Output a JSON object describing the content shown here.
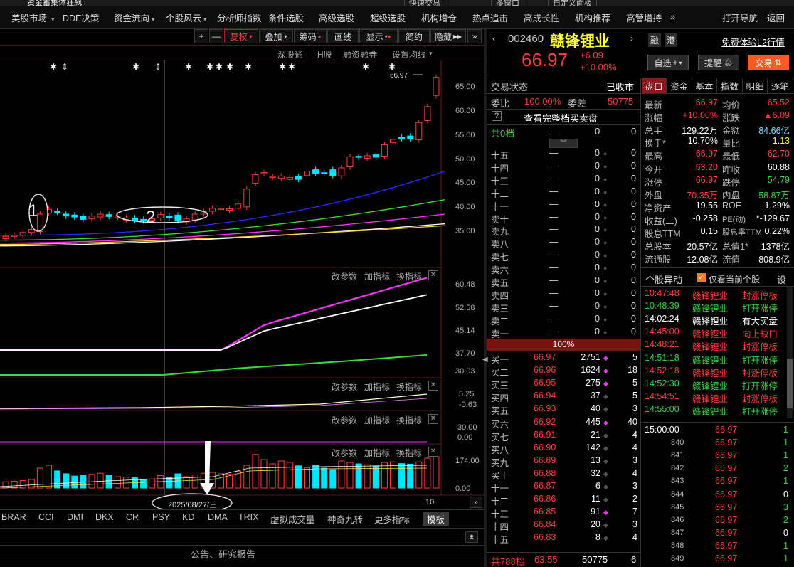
{
  "window": {
    "title": "资金蓄集体狂飙!",
    "top_buttons": [
      "快速交易",
      "多窗口",
      "自定义面板"
    ]
  },
  "menu": [
    "美股市场",
    "DDE决策",
    "资金流向",
    "个股风云",
    "分析师指数",
    "条件选股",
    "高级选股",
    "超级选股",
    "机构增仓",
    "热点追击",
    "高成长性",
    "机构推荐",
    "高管增持",
    "»"
  ],
  "menu_right": {
    "nav": "打开导航",
    "back": "返回"
  },
  "chart_toolbar": {
    "plus": "+",
    "minus": "—",
    "fuquan": "复权",
    "overlay": "叠加",
    "chouma": "筹码",
    "draw": "画线",
    "display": "显示",
    "simple": "简约",
    "hide": "隐藏"
  },
  "chart_links": [
    "深股通",
    "H股",
    "融资融券",
    "设置均线"
  ],
  "stock": {
    "code": "002460",
    "name": "赣锋锂业",
    "price": "66.97",
    "change": "+6.09",
    "change_pct": "+10.00%",
    "badge1": "融",
    "badge2": "港",
    "l2": "免费体验L2行情",
    "btn_zixuan": "自选",
    "btn_tixing": "提醒",
    "btn_jiaoyi": "交易"
  },
  "price_marker": "66.97",
  "annotations": {
    "circle1": "1",
    "circle2": "2",
    "date": "2025/08/27/三"
  },
  "y_axis_main": [
    "65.00",
    "60.00",
    "55.00",
    "50.00",
    "45.00",
    "40.00",
    "35.00"
  ],
  "y_axis_ind1": [
    "60.48",
    "52.58",
    "45.14",
    "37.70",
    "30.03"
  ],
  "y_axis_ind2": [
    "5.25",
    "-0.63"
  ],
  "y_axis_ind3": [
    "30.00",
    "0.00"
  ],
  "y_axis_vol": [
    "174.00",
    "0.00"
  ],
  "panel_links": [
    "改参数",
    "加指标",
    "换指标"
  ],
  "bottom_tabs": [
    "BRAR",
    "CCI",
    "DMI",
    "DKX",
    "CR",
    "PSY",
    "KD",
    "DMA",
    "TRIX",
    "虚拟成交量",
    "神奇九转",
    "更多指标",
    "模板"
  ],
  "page_num": "10",
  "footer": "公告、研究报告",
  "trade_status": {
    "label": "交易状态",
    "value": "已收市",
    "weibi_label": "委比",
    "weibi": "100.00%",
    "weicha_label": "委差",
    "weicha": "50775",
    "full_book": "查看完整档买卖盘",
    "total0": "共0档",
    "dash": "—",
    "zero": "0"
  },
  "sell_levels": [
    "十五",
    "十四",
    "十三",
    "十二",
    "十一",
    "卖十",
    "卖九",
    "卖八",
    "卖七",
    "卖六",
    "卖五",
    "卖四",
    "卖三",
    "卖二",
    "卖一"
  ],
  "ratio_bar": "100%",
  "buy_levels": [
    [
      "买一",
      "66.97",
      "2751",
      "5"
    ],
    [
      "买二",
      "66.96",
      "1624",
      "18"
    ],
    [
      "买三",
      "66.95",
      "275",
      "5"
    ],
    [
      "买四",
      "66.94",
      "37",
      "5"
    ],
    [
      "买五",
      "66.93",
      "40",
      "3"
    ],
    [
      "买六",
      "66.92",
      "445",
      "40"
    ],
    [
      "买七",
      "66.91",
      "21",
      "4"
    ],
    [
      "买八",
      "66.90",
      "142",
      "4"
    ],
    [
      "买九",
      "66.89",
      "13",
      "3"
    ],
    [
      "买十",
      "66.88",
      "32",
      "4"
    ],
    [
      "十一",
      "66.87",
      "6",
      "3"
    ],
    [
      "十二",
      "66.86",
      "11",
      "2"
    ],
    [
      "十三",
      "66.85",
      "91",
      "7"
    ],
    [
      "十四",
      "66.84",
      "20",
      "3"
    ],
    [
      "十五",
      "66.83",
      "8",
      "4"
    ]
  ],
  "book_total": {
    "label": "共788档",
    "price": "63.55",
    "vol": "50775",
    "cnt": "6"
  },
  "tabs": [
    "盘口",
    "资金",
    "基本",
    "指数",
    "明细",
    "逐笔"
  ],
  "stats": [
    [
      "最新",
      "66.97",
      "均价",
      "65.52"
    ],
    [
      "涨幅",
      "+10.00%",
      "涨跌",
      "▲6.09"
    ],
    [
      "总手",
      "129.22万",
      "金额",
      "84.66亿"
    ],
    [
      "换手*",
      "10.70%",
      "量比",
      "1.13"
    ],
    [
      "最高",
      "66.97",
      "最低",
      "62.70"
    ],
    [
      "今开",
      "63.20",
      "昨收",
      "60.88"
    ],
    [
      "涨停",
      "66.97",
      "跌停",
      "54.79"
    ],
    [
      "外盘",
      "70.35万",
      "内盘",
      "58.87万"
    ],
    [
      "净资产",
      "19.55",
      "ROE",
      "-1.29%"
    ],
    [
      "收益(二)",
      "-0.258",
      "PE(动)",
      "*-129.67"
    ],
    [
      "股息TTM",
      "0.15",
      "股息率TTM",
      "0.22%"
    ],
    [
      "总股本",
      "20.57亿",
      "总值1*",
      "1378亿"
    ],
    [
      "流通股",
      "12.08亿",
      "流值",
      "808.9亿"
    ]
  ],
  "anomaly": {
    "title": "个股异动",
    "only_current": "仅看当前个股",
    "settings": "设"
  },
  "anomaly_rows": [
    [
      "10:47:48",
      "赣锋锂业",
      "封涨停板",
      "red"
    ],
    [
      "10:48:39",
      "赣锋锂业",
      "打开涨停",
      "green"
    ],
    [
      "14:02:24",
      "赣锋锂业",
      "有大买盘",
      "white"
    ],
    [
      "14:45:00",
      "赣锋锂业",
      "向上缺口",
      "red"
    ],
    [
      "14:48:21",
      "赣锋锂业",
      "封涨停板",
      "red"
    ],
    [
      "14:51:18",
      "赣锋锂业",
      "打开涨停",
      "green"
    ],
    [
      "14:52:18",
      "赣锋锂业",
      "封涨停板",
      "red"
    ],
    [
      "14:52:30",
      "赣锋锂业",
      "打开涨停",
      "green"
    ],
    [
      "14:54:51",
      "赣锋锂业",
      "封涨停板",
      "red"
    ],
    [
      "14:55:00",
      "赣锋锂业",
      "打开涨停",
      "green"
    ]
  ],
  "ticks": [
    [
      "15:00:00",
      "66.97",
      "1"
    ],
    [
      "840",
      "66.97",
      "1"
    ],
    [
      "841",
      "66.97",
      "1"
    ],
    [
      "842",
      "66.97",
      "2"
    ],
    [
      "843",
      "66.97",
      "1"
    ],
    [
      "844",
      "66.97",
      "0"
    ],
    [
      "845",
      "66.97",
      "3"
    ],
    [
      "846",
      "66.97",
      "2"
    ],
    [
      "847",
      "66.97",
      "0"
    ],
    [
      "848",
      "66.97",
      "1"
    ],
    [
      "849",
      "66.97",
      "1"
    ]
  ],
  "chart_data": {
    "type": "candlestick",
    "candles": [
      [
        33.5,
        34.0
      ],
      [
        34.0,
        34.2
      ],
      [
        34.2,
        34.8
      ],
      [
        34.8,
        35.4
      ],
      [
        35.0,
        38.6
      ],
      [
        38.8,
        39.6
      ],
      [
        39.2,
        39.0
      ],
      [
        38.6,
        38.2
      ],
      [
        38.4,
        38.0
      ],
      [
        38.1,
        37.5
      ],
      [
        37.6,
        38.2
      ],
      [
        38.0,
        38.6
      ],
      [
        38.5,
        38.1
      ],
      [
        38.0,
        38.0
      ],
      [
        37.4,
        37.8
      ],
      [
        37.8,
        37.3
      ],
      [
        37.5,
        37.3
      ],
      [
        37.3,
        37.6
      ],
      [
        37.8,
        38.5
      ],
      [
        38.2,
        37.8
      ],
      [
        38.4,
        37.3
      ],
      [
        37.0,
        37.6
      ],
      [
        37.4,
        38.6
      ],
      [
        38.6,
        39.1
      ],
      [
        39.2,
        39.8
      ],
      [
        39.6,
        39.8
      ],
      [
        39.4,
        39.7
      ],
      [
        39.8,
        40.7
      ],
      [
        40.1,
        43.8
      ],
      [
        45.0,
        46.8
      ],
      [
        47.0,
        47.2
      ],
      [
        46.3,
        46.4
      ],
      [
        46.0,
        46.5
      ],
      [
        45.8,
        46.2
      ],
      [
        46.4,
        45.8
      ],
      [
        46.6,
        47.5
      ],
      [
        47.8,
        47.0
      ],
      [
        47.2,
        47.0
      ],
      [
        47.8,
        46.6
      ],
      [
        46.5,
        48.2
      ],
      [
        48.4,
        50.5
      ],
      [
        50.6,
        50.4
      ],
      [
        50.2,
        50.7
      ],
      [
        50.9,
        50.4
      ],
      [
        50.6,
        53.0
      ],
      [
        53.4,
        54.1
      ],
      [
        54.6,
        54.2
      ],
      [
        54.8,
        54.2
      ],
      [
        54.0,
        57.6
      ],
      [
        58.0,
        60.9
      ],
      [
        63.2,
        66.97
      ]
    ],
    "volume": [
      22,
      24,
      26,
      30,
      70,
      80,
      60,
      50,
      42,
      45,
      48,
      52,
      45,
      40,
      38,
      36,
      30,
      32,
      44,
      38,
      50,
      40,
      46,
      52,
      55,
      50,
      48,
      58,
      80,
      118,
      100,
      85,
      95,
      90,
      78,
      72,
      80,
      70,
      65,
      95,
      90,
      85,
      82,
      78,
      90,
      92,
      86,
      84,
      92,
      105,
      110
    ],
    "ylim": [
      33,
      68
    ]
  }
}
